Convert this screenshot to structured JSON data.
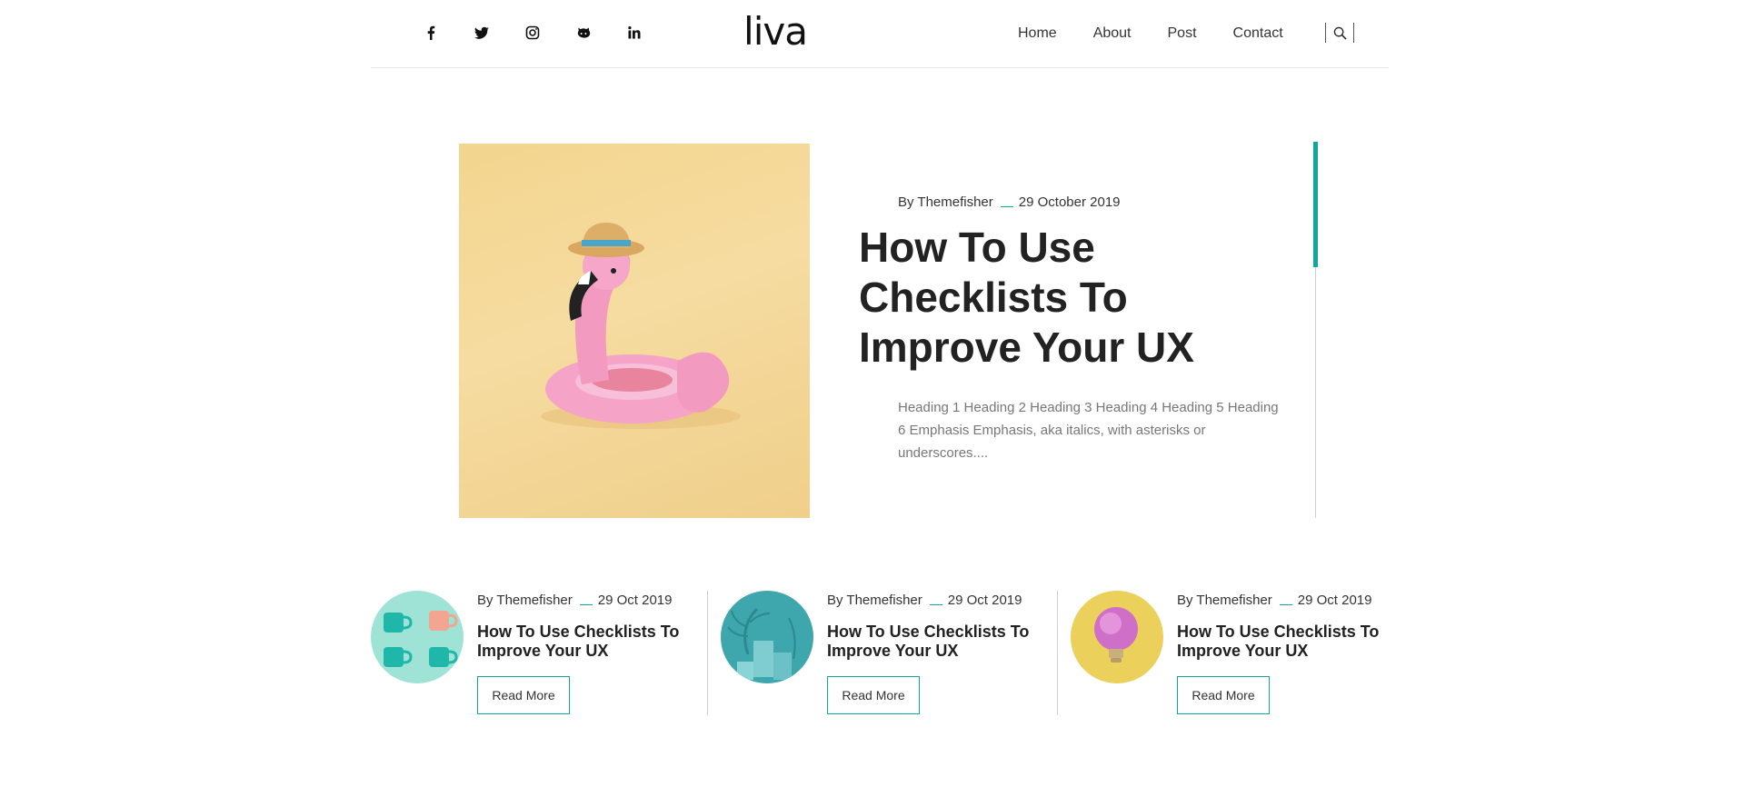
{
  "brand": {
    "logo": "liva"
  },
  "social": [
    "facebook-icon",
    "twitter-icon",
    "instagram-icon",
    "github-icon",
    "linkedin-icon"
  ],
  "nav": {
    "items": [
      "Home",
      "About",
      "Post",
      "Contact"
    ]
  },
  "featured": {
    "author": "By Themefisher",
    "date": "29 October 2019",
    "title": "How To Use Checklists To Improve Your UX",
    "excerpt": "Heading 1 Heading 2 Heading 3 Heading 4 Heading 5 Heading 6 Emphasis Emphasis, aka italics, with asterisks or underscores...."
  },
  "cards": [
    {
      "author": "By Themefisher",
      "date": "29 Oct 2019",
      "title": "How To Use Checklists To Improve Your UX",
      "button": "Read More"
    },
    {
      "author": "By Themefisher",
      "date": "29 Oct 2019",
      "title": "How To Use Checklists To Improve Your UX",
      "button": "Read More"
    },
    {
      "author": "By Themefisher",
      "date": "29 Oct 2019",
      "title": "How To Use Checklists To Improve Your UX",
      "button": "Read More"
    }
  ],
  "colors": {
    "accent": "#10a89b",
    "text": "#222222",
    "muted": "#777777"
  }
}
